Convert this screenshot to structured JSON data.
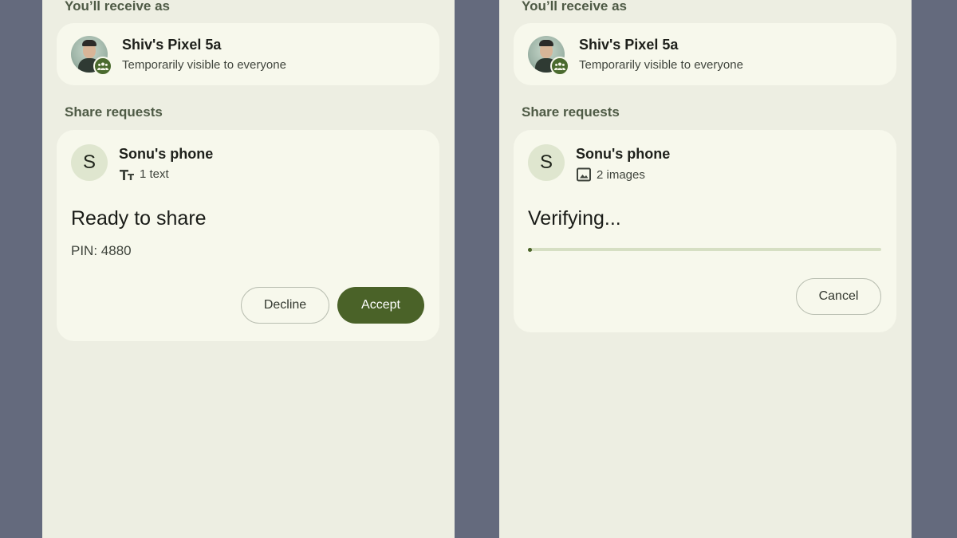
{
  "screens": [
    {
      "receive_label": "You’ll receive as",
      "device_name": "Shiv's Pixel 5a",
      "visibility": "Temporarily visible to everyone",
      "requests_label": "Share requests",
      "request": {
        "avatar_letter": "S",
        "sender": "Sonu's phone",
        "payload_icon": "text-format-icon",
        "payload": "1 text",
        "status": "Ready to share",
        "pin": "PIN: 4880",
        "decline_label": "Decline",
        "accept_label": "Accept"
      }
    },
    {
      "receive_label": "You’ll receive as",
      "device_name": "Shiv's Pixel 5a",
      "visibility": "Temporarily visible to everyone",
      "requests_label": "Share requests",
      "request": {
        "avatar_letter": "S",
        "sender": "Sonu's phone",
        "payload_icon": "image-icon",
        "payload": "2 images",
        "status": "Verifying...",
        "progress": 0.01,
        "cancel_label": "Cancel"
      }
    }
  ],
  "colors": {
    "backdrop": "#646a7d",
    "screen_bg": "#edeee2",
    "card_bg": "#f7f8ec",
    "accent": "#4a6228",
    "progress_track": "#d6dfc3"
  }
}
